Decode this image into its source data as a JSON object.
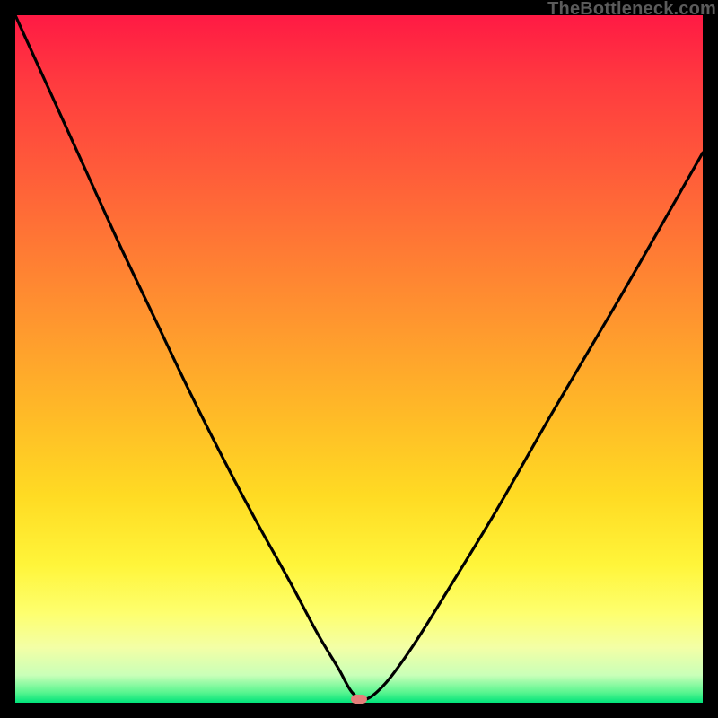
{
  "watermark": "TheBottleneck.com",
  "chart_data": {
    "type": "line",
    "title": "",
    "xlabel": "",
    "ylabel": "",
    "xlim": [
      0,
      100
    ],
    "ylim": [
      0,
      100
    ],
    "legend": false,
    "grid": false,
    "background_gradient": {
      "direction": "vertical",
      "stops": [
        {
          "pos": 0,
          "color": "#ff1a44"
        },
        {
          "pos": 50,
          "color": "#ffba27"
        },
        {
          "pos": 85,
          "color": "#feff6f"
        },
        {
          "pos": 100,
          "color": "#00e37a"
        }
      ]
    },
    "series": [
      {
        "name": "bottleneck-curve",
        "color": "#000000",
        "x": [
          0,
          5,
          10,
          15,
          20,
          25,
          30,
          35,
          40,
          44,
          47,
          49,
          51,
          54,
          58,
          63,
          70,
          78,
          88,
          100
        ],
        "y": [
          100,
          89,
          78,
          67,
          56.5,
          46,
          36,
          26.5,
          17.5,
          10,
          5,
          1.5,
          0.5,
          3,
          8.5,
          16.5,
          28,
          42,
          59,
          80
        ]
      }
    ],
    "marker": {
      "x": 50,
      "y": 0.5,
      "color": "#e57f7a"
    }
  }
}
